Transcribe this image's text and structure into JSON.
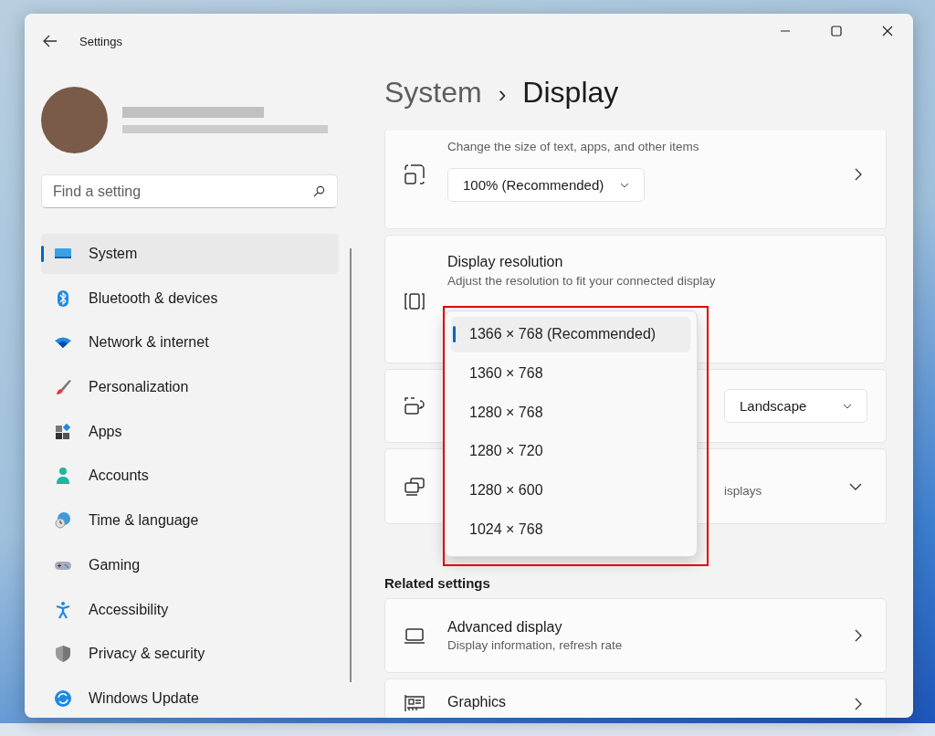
{
  "window": {
    "title": "Settings"
  },
  "search": {
    "placeholder": "Find a setting"
  },
  "sidebar": {
    "items": [
      {
        "label": "System",
        "selected": true
      },
      {
        "label": "Bluetooth & devices",
        "selected": false
      },
      {
        "label": "Network & internet",
        "selected": false
      },
      {
        "label": "Personalization",
        "selected": false
      },
      {
        "label": "Apps",
        "selected": false
      },
      {
        "label": "Accounts",
        "selected": false
      },
      {
        "label": "Time & language",
        "selected": false
      },
      {
        "label": "Gaming",
        "selected": false
      },
      {
        "label": "Accessibility",
        "selected": false
      },
      {
        "label": "Privacy & security",
        "selected": false
      },
      {
        "label": "Windows Update",
        "selected": false
      }
    ]
  },
  "breadcrumb": {
    "parent": "System",
    "separator": "›",
    "current": "Display"
  },
  "cards": [
    {
      "kind": "dropdown-below",
      "description": "Change the size of text, apps, and other items",
      "value": "100% (Recommended)"
    },
    {
      "kind": "resolution",
      "title": "Display resolution",
      "description": "Adjust the resolution to fit your connected display"
    },
    {
      "kind": "dropdown-right",
      "value": "Landscape"
    },
    {
      "kind": "expander",
      "description": "isplays",
      "expanded": false
    }
  ],
  "related": {
    "heading": "Related settings",
    "items": [
      {
        "title": "Advanced display",
        "description": "Display information, refresh rate"
      },
      {
        "title": "Graphics"
      }
    ]
  },
  "resolution_menu": {
    "options": [
      {
        "label": "1366 × 768 (Recommended)",
        "selected": true
      },
      {
        "label": "1360 × 768",
        "selected": false
      },
      {
        "label": "1280 × 768",
        "selected": false
      },
      {
        "label": "1280 × 720",
        "selected": false
      },
      {
        "label": "1280 × 600",
        "selected": false
      },
      {
        "label": "1024 × 768",
        "selected": false
      }
    ]
  }
}
